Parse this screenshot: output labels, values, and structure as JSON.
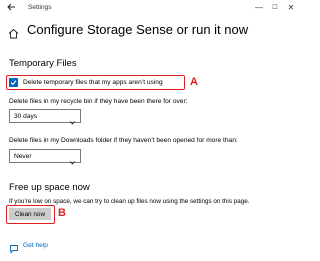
{
  "window": {
    "title": "Settings",
    "back_icon": "back-arrow-icon",
    "controls": {
      "minimize": "—",
      "maximize": "☐",
      "close": "✕"
    }
  },
  "page": {
    "title": "Configure Storage Sense or run it now",
    "icon": "home-icon"
  },
  "temporary_files": {
    "heading": "Temporary Files",
    "checkbox_label": "Delete temporary files that my apps aren’t using",
    "checkbox_checked": true,
    "annotation": "A",
    "recycle_bin": {
      "label": "Delete files in my recycle bin if they have been there for over:",
      "value": "30 days"
    },
    "downloads": {
      "label": "Delete files in my Downloads folder if they haven’t been opened for more than:",
      "value": "Never"
    }
  },
  "free_up": {
    "heading": "Free up space now",
    "description": "If you’re low on space, we can try to clean up files now using the settings on this page.",
    "button_label": "Clean now",
    "annotation": "B"
  },
  "footer": {
    "help_label": "Get help",
    "help_icon": "help-chat-icon"
  },
  "colors": {
    "accent": "#0067c0",
    "annotation": "#e02020",
    "button_bg": "#cccccc"
  }
}
